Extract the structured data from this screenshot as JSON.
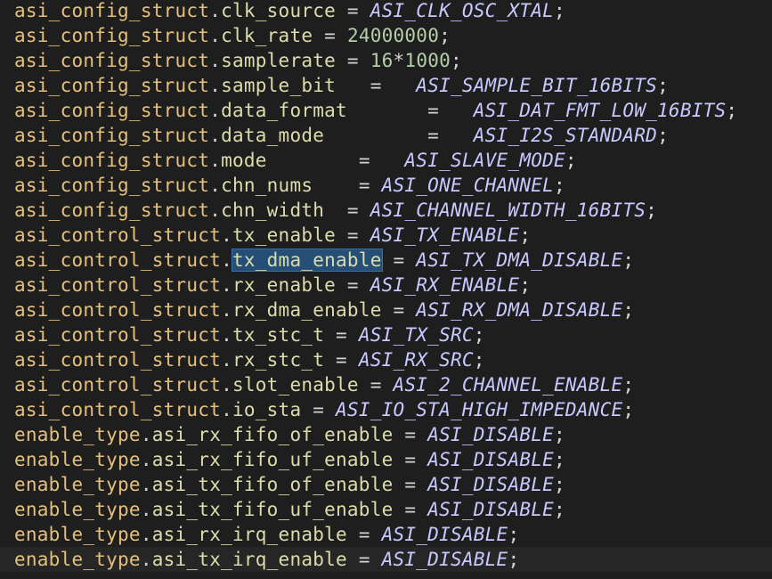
{
  "editor": {
    "lines": [
      {
        "parts": [
          {
            "t": "asi_config_struct",
            "c": "obj"
          },
          {
            "t": ".",
            "c": "punc"
          },
          {
            "t": "clk_source",
            "c": "mem"
          },
          {
            "t": " = ",
            "c": "op"
          },
          {
            "t": "ASI_CLK_OSC_XTAL",
            "c": "const"
          },
          {
            "t": ";",
            "c": "punc"
          }
        ]
      },
      {
        "parts": [
          {
            "t": "asi_config_struct",
            "c": "obj"
          },
          {
            "t": ".",
            "c": "punc"
          },
          {
            "t": "clk_rate",
            "c": "mem"
          },
          {
            "t": " = ",
            "c": "op"
          },
          {
            "t": "24000000",
            "c": "num"
          },
          {
            "t": ";",
            "c": "punc"
          }
        ]
      },
      {
        "parts": [
          {
            "t": "asi_config_struct",
            "c": "obj"
          },
          {
            "t": ".",
            "c": "punc"
          },
          {
            "t": "samplerate",
            "c": "mem"
          },
          {
            "t": " = ",
            "c": "op"
          },
          {
            "t": "16",
            "c": "num"
          },
          {
            "t": "*",
            "c": "op"
          },
          {
            "t": "1000",
            "c": "num"
          },
          {
            "t": ";",
            "c": "punc"
          }
        ]
      },
      {
        "parts": [
          {
            "t": "asi_config_struct",
            "c": "obj"
          },
          {
            "t": ".",
            "c": "punc"
          },
          {
            "t": "sample_bit",
            "c": "mem"
          },
          {
            "t": "   =   ",
            "c": "op"
          },
          {
            "t": "ASI_SAMPLE_BIT_16BITS",
            "c": "const"
          },
          {
            "t": ";",
            "c": "punc"
          }
        ]
      },
      {
        "parts": [
          {
            "t": "asi_config_struct",
            "c": "obj"
          },
          {
            "t": ".",
            "c": "punc"
          },
          {
            "t": "data_format",
            "c": "mem"
          },
          {
            "t": "       =   ",
            "c": "op"
          },
          {
            "t": "ASI_DAT_FMT_LOW_16BITS",
            "c": "const"
          },
          {
            "t": ";",
            "c": "punc"
          }
        ]
      },
      {
        "parts": [
          {
            "t": "asi_config_struct",
            "c": "obj"
          },
          {
            "t": ".",
            "c": "punc"
          },
          {
            "t": "data_mode",
            "c": "mem"
          },
          {
            "t": "         =   ",
            "c": "op"
          },
          {
            "t": "ASI_I2S_STANDARD",
            "c": "const"
          },
          {
            "t": ";",
            "c": "punc"
          }
        ]
      },
      {
        "parts": [
          {
            "t": "asi_config_struct",
            "c": "obj"
          },
          {
            "t": ".",
            "c": "punc"
          },
          {
            "t": "mode",
            "c": "mem"
          },
          {
            "t": "        =   ",
            "c": "op"
          },
          {
            "t": "ASI_SLAVE_MODE",
            "c": "const"
          },
          {
            "t": ";",
            "c": "punc"
          }
        ]
      },
      {
        "parts": [
          {
            "t": "asi_config_struct",
            "c": "obj"
          },
          {
            "t": ".",
            "c": "punc"
          },
          {
            "t": "chn_nums",
            "c": "mem"
          },
          {
            "t": "    = ",
            "c": "op"
          },
          {
            "t": "ASI_ONE_CHANNEL",
            "c": "const"
          },
          {
            "t": ";",
            "c": "punc"
          }
        ]
      },
      {
        "parts": [
          {
            "t": "asi_config_struct",
            "c": "obj"
          },
          {
            "t": ".",
            "c": "punc"
          },
          {
            "t": "chn_width",
            "c": "mem"
          },
          {
            "t": "  = ",
            "c": "op"
          },
          {
            "t": "ASI_CHANNEL_WIDTH_16BITS",
            "c": "const"
          },
          {
            "t": ";",
            "c": "punc"
          }
        ]
      },
      {
        "parts": [
          {
            "t": "asi_control_struct",
            "c": "obj"
          },
          {
            "t": ".",
            "c": "punc"
          },
          {
            "t": "tx_enable",
            "c": "mem"
          },
          {
            "t": " = ",
            "c": "op"
          },
          {
            "t": "ASI_TX_ENABLE",
            "c": "const"
          },
          {
            "t": ";",
            "c": "punc"
          }
        ]
      },
      {
        "parts": [
          {
            "t": "asi_control_struct",
            "c": "obj"
          },
          {
            "t": ".",
            "c": "punc"
          },
          {
            "t": "tx_dma_enable",
            "c": "mem",
            "sel": true
          },
          {
            "t": " = ",
            "c": "op"
          },
          {
            "t": "ASI_TX_DMA_DISABLE",
            "c": "const"
          },
          {
            "t": ";",
            "c": "punc"
          }
        ]
      },
      {
        "parts": [
          {
            "t": "asi_control_struct",
            "c": "obj"
          },
          {
            "t": ".",
            "c": "punc"
          },
          {
            "t": "rx_enable",
            "c": "mem"
          },
          {
            "t": " = ",
            "c": "op"
          },
          {
            "t": "ASI_RX_ENABLE",
            "c": "const"
          },
          {
            "t": ";",
            "c": "punc"
          }
        ]
      },
      {
        "parts": [
          {
            "t": "asi_control_struct",
            "c": "obj"
          },
          {
            "t": ".",
            "c": "punc"
          },
          {
            "t": "rx_dma_enable",
            "c": "mem"
          },
          {
            "t": " = ",
            "c": "op"
          },
          {
            "t": "ASI_RX_DMA_DISABLE",
            "c": "const"
          },
          {
            "t": ";",
            "c": "punc"
          }
        ]
      },
      {
        "parts": [
          {
            "t": "asi_control_struct",
            "c": "obj"
          },
          {
            "t": ".",
            "c": "punc"
          },
          {
            "t": "tx_stc_t",
            "c": "mem"
          },
          {
            "t": " = ",
            "c": "op"
          },
          {
            "t": "ASI_TX_SRC",
            "c": "const"
          },
          {
            "t": ";",
            "c": "punc"
          }
        ]
      },
      {
        "parts": [
          {
            "t": "asi_control_struct",
            "c": "obj"
          },
          {
            "t": ".",
            "c": "punc"
          },
          {
            "t": "rx_stc_t",
            "c": "mem"
          },
          {
            "t": " = ",
            "c": "op"
          },
          {
            "t": "ASI_RX_SRC",
            "c": "const"
          },
          {
            "t": ";",
            "c": "punc"
          }
        ]
      },
      {
        "parts": [
          {
            "t": "asi_control_struct",
            "c": "obj"
          },
          {
            "t": ".",
            "c": "punc"
          },
          {
            "t": "slot_enable",
            "c": "mem"
          },
          {
            "t": " = ",
            "c": "op"
          },
          {
            "t": "ASI_2_CHANNEL_ENABLE",
            "c": "const"
          },
          {
            "t": ";",
            "c": "punc"
          }
        ]
      },
      {
        "parts": [
          {
            "t": "asi_control_struct",
            "c": "obj"
          },
          {
            "t": ".",
            "c": "punc"
          },
          {
            "t": "io_sta",
            "c": "mem"
          },
          {
            "t": " = ",
            "c": "op"
          },
          {
            "t": "ASI_IO_STA_HIGH_IMPEDANCE",
            "c": "const"
          },
          {
            "t": ";",
            "c": "punc"
          }
        ]
      },
      {
        "parts": [
          {
            "t": "enable_type",
            "c": "obj"
          },
          {
            "t": ".",
            "c": "punc"
          },
          {
            "t": "asi_rx_fifo_of_enable",
            "c": "mem"
          },
          {
            "t": " = ",
            "c": "op"
          },
          {
            "t": "ASI_DISABLE",
            "c": "const"
          },
          {
            "t": ";",
            "c": "punc"
          }
        ]
      },
      {
        "parts": [
          {
            "t": "enable_type",
            "c": "obj"
          },
          {
            "t": ".",
            "c": "punc"
          },
          {
            "t": "asi_rx_fifo_uf_enable",
            "c": "mem"
          },
          {
            "t": " = ",
            "c": "op"
          },
          {
            "t": "ASI_DISABLE",
            "c": "const"
          },
          {
            "t": ";",
            "c": "punc"
          }
        ]
      },
      {
        "parts": [
          {
            "t": "enable_type",
            "c": "obj"
          },
          {
            "t": ".",
            "c": "punc"
          },
          {
            "t": "asi_tx_fifo_of_enable",
            "c": "mem"
          },
          {
            "t": " = ",
            "c": "op"
          },
          {
            "t": "ASI_DISABLE",
            "c": "const"
          },
          {
            "t": ";",
            "c": "punc"
          }
        ]
      },
      {
        "parts": [
          {
            "t": "enable_type",
            "c": "obj"
          },
          {
            "t": ".",
            "c": "punc"
          },
          {
            "t": "asi_tx_fifo_uf_enable",
            "c": "mem"
          },
          {
            "t": " = ",
            "c": "op"
          },
          {
            "t": "ASI_DISABLE",
            "c": "const"
          },
          {
            "t": ";",
            "c": "punc"
          }
        ]
      },
      {
        "parts": [
          {
            "t": "enable_type",
            "c": "obj"
          },
          {
            "t": ".",
            "c": "punc"
          },
          {
            "t": "asi_rx_irq_enable",
            "c": "mem"
          },
          {
            "t": " = ",
            "c": "op"
          },
          {
            "t": "ASI_DISABLE",
            "c": "const"
          },
          {
            "t": ";",
            "c": "punc"
          }
        ]
      },
      {
        "current": true,
        "parts": [
          {
            "t": "enable_type",
            "c": "obj"
          },
          {
            "t": ".",
            "c": "punc"
          },
          {
            "t": "asi_tx_irq_enable",
            "c": "mem"
          },
          {
            "t": " = ",
            "c": "op"
          },
          {
            "t": "ASI_DISABLE",
            "c": "const"
          },
          {
            "t": ";",
            "c": "punc"
          }
        ]
      }
    ]
  },
  "colors": {
    "background": "#1e1e1e",
    "current_line": "#262626",
    "selection": "#264f78",
    "object": "#e5c07b",
    "member": "#dcdcaa",
    "constant": "#c8c8ff",
    "number": "#b5cea8",
    "operator": "#d4d4d4"
  }
}
